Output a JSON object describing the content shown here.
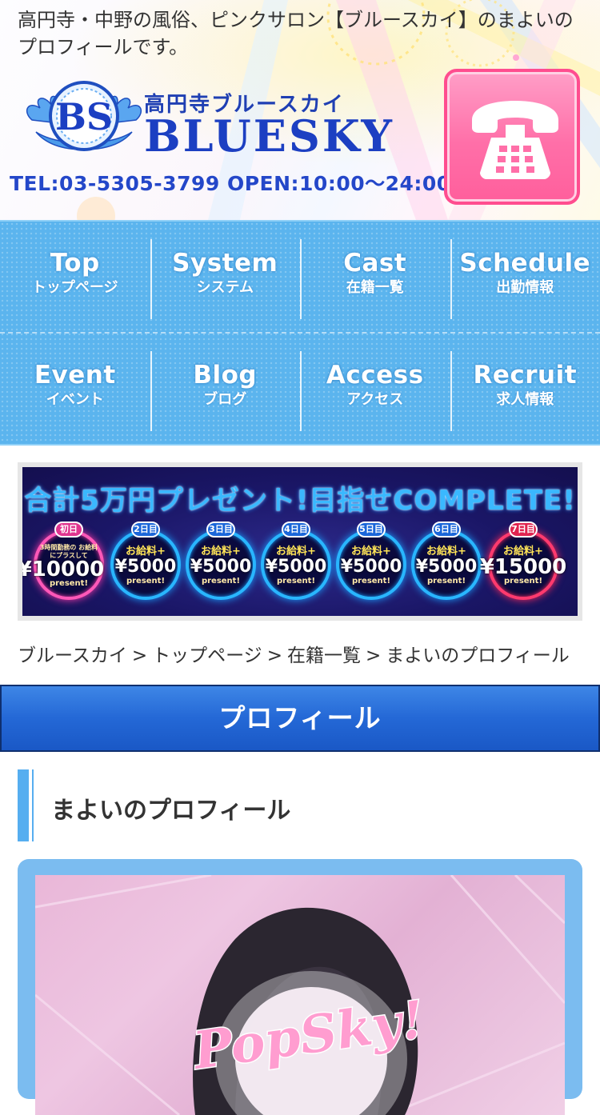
{
  "header": {
    "intro_text": "高円寺・中野の風俗、ピンクサロン【ブルースカイ】のまよいのプロフィールです。",
    "logo_emblem": "BS",
    "logo_sub": "高円寺ブルースカイ",
    "logo_main": "BLUESKY",
    "contact": "TEL:03-5305-3799 OPEN:10:00〜24:00",
    "phone_icon": "telephone-icon"
  },
  "nav": {
    "items": [
      {
        "en": "Top",
        "jp": "トップページ"
      },
      {
        "en": "System",
        "jp": "システム"
      },
      {
        "en": "Cast",
        "jp": "在籍一覧"
      },
      {
        "en": "Schedule",
        "jp": "出勤情報"
      },
      {
        "en": "Event",
        "jp": "イベント"
      },
      {
        "en": "Blog",
        "jp": "ブログ"
      },
      {
        "en": "Access",
        "jp": "アクセス"
      },
      {
        "en": "Recruit",
        "jp": "求人情報"
      }
    ]
  },
  "banner": {
    "title": "合計5万円プレゼント!目指せCOMPLETE!",
    "days": [
      {
        "tag": "初日",
        "sub": "3時間勤務の お給料にプラスして",
        "amount": "¥10000",
        "present": "present!"
      },
      {
        "tag": "2日目",
        "sub": "お給料+",
        "amount": "¥5000",
        "present": "present!"
      },
      {
        "tag": "3日目",
        "sub": "お給料+",
        "amount": "¥5000",
        "present": "present!"
      },
      {
        "tag": "4日目",
        "sub": "お給料+",
        "amount": "¥5000",
        "present": "present!"
      },
      {
        "tag": "5日目",
        "sub": "お給料+",
        "amount": "¥5000",
        "present": "present!"
      },
      {
        "tag": "6日目",
        "sub": "お給料+",
        "amount": "¥5000",
        "present": "present!"
      },
      {
        "tag": "7日目",
        "sub": "お給料+",
        "amount": "¥15000",
        "present": "present!"
      }
    ]
  },
  "breadcrumb": {
    "items": [
      "ブルースカイ",
      "トップページ",
      "在籍一覧",
      "まよいのプロフィール"
    ],
    "separator": ">"
  },
  "section_title": "プロフィール",
  "profile": {
    "heading": "まよいのプロフィール",
    "photo_watermark": "PopSky!"
  },
  "colors": {
    "nav_blue": "#5bb4ee",
    "section_blue": "#2468d6",
    "accent_pink": "#ff6fa8",
    "logo_blue": "#1c3fc2"
  }
}
